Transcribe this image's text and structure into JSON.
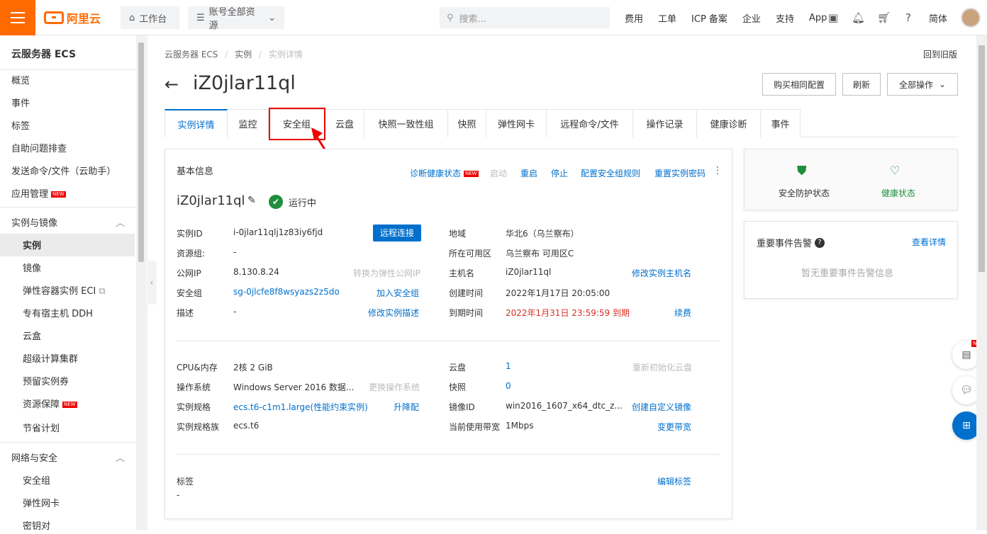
{
  "topbar": {
    "logo": "阿里云",
    "workbench": "工作台",
    "resources": "账号全部资源",
    "search_placeholder": "搜索...",
    "nav": [
      "费用",
      "工单",
      "ICP 备案",
      "企业",
      "支持",
      "App"
    ],
    "lang": "简体"
  },
  "sidebar": {
    "title": "云服务器 ECS",
    "items": [
      "概览",
      "事件",
      "标签",
      "自助问题排查",
      "发送命令/文件（云助手）",
      "应用管理"
    ],
    "group1": "实例与镜像",
    "group1_items": [
      "实例",
      "镜像",
      "弹性容器实例 ECI",
      "专有宿主机 DDH",
      "云盒",
      "超级计算集群",
      "预留实例券",
      "资源保障",
      "节省计划"
    ],
    "group2": "网络与安全",
    "group2_items": [
      "安全组",
      "弹性网卡",
      "密钥对"
    ],
    "new_badge": "NEW"
  },
  "breadcrumb": [
    "云服务器 ECS",
    "实例",
    "实例详情"
  ],
  "old_version": "回到旧版",
  "page_title": "iZ0jlar11ql",
  "actions": {
    "buy": "购买相同配置",
    "refresh": "刷新",
    "all": "全部操作"
  },
  "tabs": [
    "实例详情",
    "监控",
    "安全组",
    "云盘",
    "快照一致性组",
    "快照",
    "弹性网卡",
    "远程命令/文件",
    "操作记录",
    "健康诊断",
    "事件"
  ],
  "basic": {
    "title": "基本信息",
    "diagnose": "诊断健康状态",
    "start": "启动",
    "restart": "重启",
    "stop": "停止",
    "config_sg": "配置安全组规则",
    "reset_pwd": "重置实例密码",
    "name": "iZ0jlar11ql",
    "status": "运行中",
    "left": [
      {
        "l": "实例ID",
        "v": "i-0jlar11qlj1z83iy6fjd"
      },
      {
        "l": "资源组:",
        "v": "-"
      },
      {
        "l": "公网IP",
        "v": "8.130.8.24"
      },
      {
        "l": "安全组",
        "v": "sg-0jlcfe8f8wsyazs2z5do"
      },
      {
        "l": "描述",
        "v": "-"
      }
    ],
    "remote": "远程连接",
    "to_eip": "转换为弹性公网IP",
    "join_sg": "加入安全组",
    "edit_desc": "修改实例描述",
    "right": [
      {
        "l": "地域",
        "v": "华北6（乌兰察布）"
      },
      {
        "l": "所在可用区",
        "v": "乌兰察布 可用区C"
      },
      {
        "l": "主机名",
        "v": "iZ0jlar11ql"
      },
      {
        "l": "创建时间",
        "v": "2022年1月17日 20:05:00"
      },
      {
        "l": "到期时间",
        "v": "2022年1月31日 23:59:59 到期"
      }
    ],
    "edit_host": "修改实例主机名",
    "renew": "续费",
    "spec_left": [
      {
        "l": "CPU&内存",
        "v": "2核 2 GiB"
      },
      {
        "l": "操作系统",
        "v": "Windows Server 2016 数据..."
      },
      {
        "l": "实例规格",
        "v": "ecs.t6-c1m1.large(性能约束实例)"
      },
      {
        "l": "实例规格族",
        "v": "ecs.t6"
      }
    ],
    "change_os": "更换操作系统",
    "upgrade": "升降配",
    "spec_right": [
      {
        "l": "云盘",
        "v": "1"
      },
      {
        "l": "快照",
        "v": "0"
      },
      {
        "l": "镜像ID",
        "v": "win2016_1607_x64_dtc_z..."
      },
      {
        "l": "当前使用带宽",
        "v": "1Mbps"
      }
    ],
    "reinit": "重新初始化云盘",
    "create_image": "创建自定义镜像",
    "change_bw": "变更带宽",
    "tags_label": "标签",
    "tags_value": "-",
    "edit_tags": "编辑标签"
  },
  "status_card": {
    "security": "安全防护状态",
    "health": "健康状态"
  },
  "events_card": {
    "title": "重要事件告警",
    "detail": "查看详情",
    "empty": "暂无重要事件告警信息"
  }
}
